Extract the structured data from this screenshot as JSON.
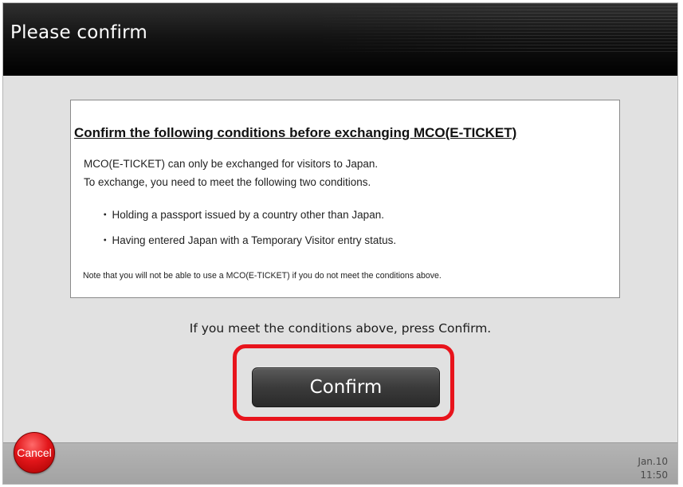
{
  "header": {
    "title": "Please confirm"
  },
  "notice": {
    "heading": "Confirm the following conditions before exchanging MCO(E-TICKET)",
    "intro_line1": "MCO(E-TICKET) can only be exchanged for visitors to Japan.",
    "intro_line2": "To exchange, you need to meet the following two conditions.",
    "bullet_marker": "・",
    "conditions": [
      "Holding a passport issued by a country other than Japan.",
      "Having entered Japan with a Temporary Visitor entry status."
    ],
    "note": "Note that you will not be able to use a MCO(E-TICKET) if you do not meet the conditions above."
  },
  "instruction": "If you meet the conditions above, press Confirm.",
  "buttons": {
    "confirm_label": "Confirm",
    "cancel_label": "Cancel"
  },
  "datetime": {
    "date": "Jan.10",
    "time": "11:50"
  },
  "colors": {
    "highlight": "#e8141c",
    "cancel_button": "#e2161a",
    "confirm_button": "#3b3b3b",
    "header": "#000000"
  }
}
